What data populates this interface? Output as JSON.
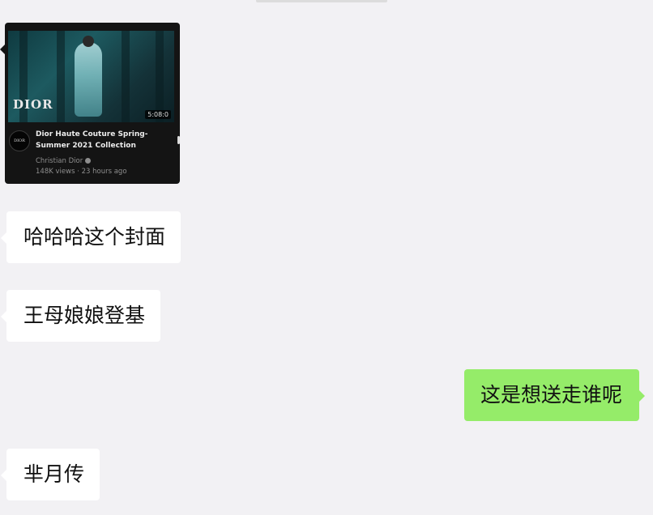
{
  "video_card": {
    "logo_text": "DIOR",
    "duration": "5:08:0",
    "channel_avatar_text": "DIOR",
    "title": "Dior Haute Couture Spring-Summer 2021 Collection",
    "channel": "Christian Dior",
    "stats": "148K views · 23 hours ago"
  },
  "messages": [
    {
      "side": "incoming",
      "text": "哈哈哈这个封面"
    },
    {
      "side": "incoming",
      "text": "王母娘娘登基"
    },
    {
      "side": "outgoing",
      "text": "这是想送走谁呢"
    },
    {
      "side": "incoming",
      "text": "芈月传"
    }
  ],
  "colors": {
    "background": "#f2f1f4",
    "incoming_bubble": "#ffffff",
    "outgoing_bubble": "#95ec69",
    "card_background": "#141414"
  }
}
